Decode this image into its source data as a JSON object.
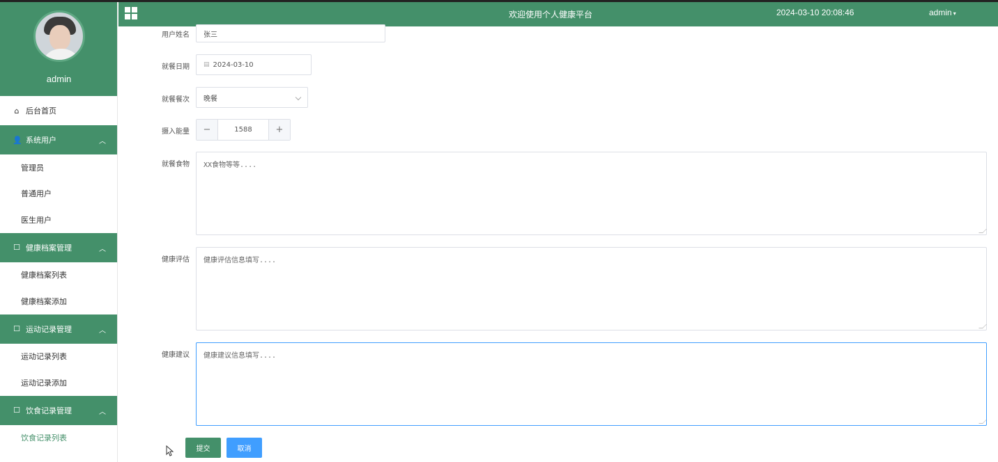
{
  "header": {
    "title": "欢迎使用个人健康平台",
    "datetime": "2024-03-10 20:08:46",
    "user": "admin"
  },
  "sidebar": {
    "username": "admin",
    "home": "后台首页",
    "groups": [
      {
        "label": "系统用户",
        "items": [
          "管理员",
          "普通用户",
          "医生用户"
        ]
      },
      {
        "label": "健康档案管理",
        "items": [
          "健康档案列表",
          "健康档案添加"
        ]
      },
      {
        "label": "运动记录管理",
        "items": [
          "运动记录列表",
          "运动记录添加"
        ]
      },
      {
        "label": "饮食记录管理",
        "items": [
          "饮食记录列表"
        ]
      }
    ]
  },
  "form": {
    "user_name": {
      "label": "用户姓名",
      "value": "张三"
    },
    "meal_date": {
      "label": "就餐日期",
      "value": "2024-03-10"
    },
    "meal_type": {
      "label": "就餐餐次",
      "value": "晚餐"
    },
    "energy": {
      "label": "摄入能量",
      "value": "1588",
      "minus": "−",
      "plus": "+"
    },
    "food": {
      "label": "就餐食物",
      "placeholder": "XX食物等等...."
    },
    "assessment": {
      "label": "健康评估",
      "placeholder": "健康评估信息填写...."
    },
    "advice": {
      "label": "健康建议",
      "placeholder": "健康建议信息填写...."
    },
    "submit": "提交",
    "cancel": "取消"
  },
  "colors": {
    "theme_green": "#44906a",
    "cancel_blue": "#409eff",
    "focus_border": "#409eff"
  }
}
